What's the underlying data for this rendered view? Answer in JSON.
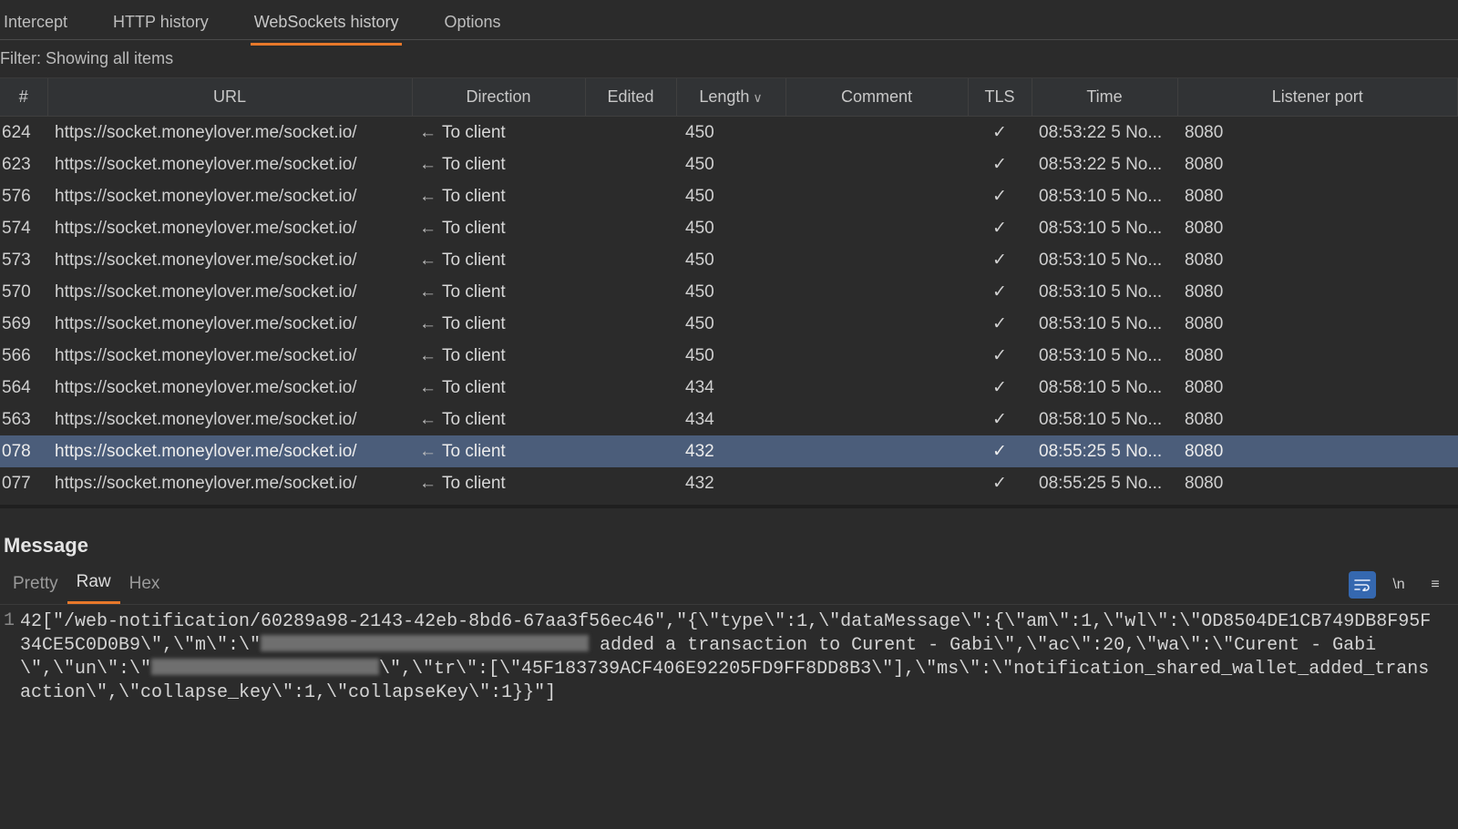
{
  "tabs": [
    "Intercept",
    "HTTP history",
    "WebSockets history",
    "Options"
  ],
  "tabs_active_index": 2,
  "filter_text": "Filter: Showing all items",
  "columns": [
    "#",
    "URL",
    "Direction",
    "Edited",
    "Length",
    "Comment",
    "TLS",
    "Time",
    "Listener port"
  ],
  "sort_column": "Length",
  "sort_dir": "desc",
  "direction_arrow": "←",
  "direction_label": "To client",
  "tls_check": "✓",
  "rows": [
    {
      "num": "624",
      "url": "https://socket.moneylover.me/socket.io/",
      "len": "450",
      "time": "08:53:22 5 No...",
      "port": "8080"
    },
    {
      "num": "623",
      "url": "https://socket.moneylover.me/socket.io/",
      "len": "450",
      "time": "08:53:22 5 No...",
      "port": "8080"
    },
    {
      "num": "576",
      "url": "https://socket.moneylover.me/socket.io/",
      "len": "450",
      "time": "08:53:10 5 No...",
      "port": "8080"
    },
    {
      "num": "574",
      "url": "https://socket.moneylover.me/socket.io/",
      "len": "450",
      "time": "08:53:10 5 No...",
      "port": "8080"
    },
    {
      "num": "573",
      "url": "https://socket.moneylover.me/socket.io/",
      "len": "450",
      "time": "08:53:10 5 No...",
      "port": "8080"
    },
    {
      "num": "570",
      "url": "https://socket.moneylover.me/socket.io/",
      "len": "450",
      "time": "08:53:10 5 No...",
      "port": "8080"
    },
    {
      "num": "569",
      "url": "https://socket.moneylover.me/socket.io/",
      "len": "450",
      "time": "08:53:10 5 No...",
      "port": "8080"
    },
    {
      "num": "566",
      "url": "https://socket.moneylover.me/socket.io/",
      "len": "450",
      "time": "08:53:10 5 No...",
      "port": "8080"
    },
    {
      "num": "564",
      "url": "https://socket.moneylover.me/socket.io/",
      "len": "434",
      "time": "08:58:10 5 No...",
      "port": "8080"
    },
    {
      "num": "563",
      "url": "https://socket.moneylover.me/socket.io/",
      "len": "434",
      "time": "08:58:10 5 No...",
      "port": "8080"
    },
    {
      "num": "078",
      "url": "https://socket.moneylover.me/socket.io/",
      "len": "432",
      "time": "08:55:25 5 No...",
      "port": "8080",
      "selected": true
    },
    {
      "num": "077",
      "url": "https://socket.moneylover.me/socket.io/",
      "len": "432",
      "time": "08:55:25 5 No...",
      "port": "8080"
    }
  ],
  "message": {
    "title": "Message",
    "tabs": [
      "Pretty",
      "Raw",
      "Hex"
    ],
    "active_tab_index": 1,
    "tool_wrap_label": "\\n",
    "gutter": "1",
    "raw_parts": {
      "p1": "42[\"/web-notification/60289a98-2143-42eb-8bd6-67aa3f56ec46\",\"{\\\"type\\\":1,\\\"dataMessage\\\":{\\\"am\\\":1,\\\"wl\\\":\\\"OD8504DE1CB749DB8F95F34CE5C0D0B9\\\",\\\"m\\\":\\\"",
      "p2": " added a transaction to Curent - Gabi\\\",\\\"ac\\\":20,\\\"wa\\\":\\\"Curent - Gabi\\\",\\\"un\\\":\\\"",
      "p3": "\\\",\\\"tr\\\":[\\\"45F183739ACF406E92205FD9FF8DD8B3\\\"],\\\"ms\\\":\\\"notification_shared_wallet_added_transaction\\\",\\\"collapse_key\\\":1,\\\"collapseKey\\\":1}}\"]"
    }
  }
}
